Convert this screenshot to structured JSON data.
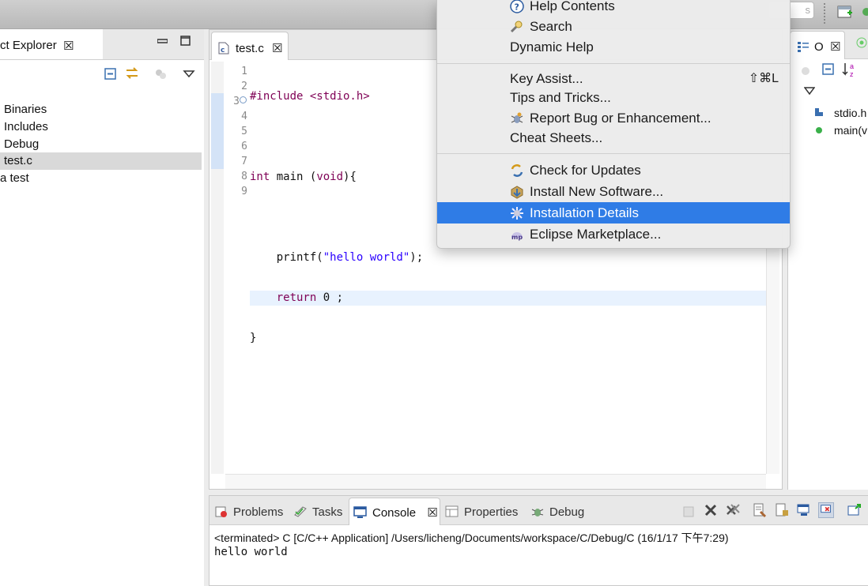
{
  "toolbar": {
    "quick_access_placeholder": "s"
  },
  "explorer": {
    "title": "ct Explorer",
    "close": "☒",
    "items": [
      {
        "label": "Binaries"
      },
      {
        "label": "Includes"
      },
      {
        "label": "Debug"
      },
      {
        "label": "test.c"
      },
      {
        "label": "a  test"
      }
    ]
  },
  "editor": {
    "tab_label": "test.c",
    "tab_close": "☒",
    "line_numbers": [
      "1",
      "2",
      "3",
      "4",
      "5",
      "6",
      "7",
      "8",
      "9"
    ],
    "code": {
      "line1": "#include <stdio.h>",
      "line3_kw": "int",
      "line3_rest": " main (",
      "line3_kw2": "void",
      "line3_end": "){",
      "line5_a": "    printf(",
      "line5_str": "\"hello world\"",
      "line5_b": ");",
      "line6_kw": "    return",
      "line6_rest": " 0 ;",
      "line7": "}"
    }
  },
  "outline": {
    "label": "O",
    "close": "☒",
    "items": [
      {
        "label": "stdio.h"
      },
      {
        "label": "main(v"
      }
    ]
  },
  "console": {
    "tabs": [
      "Problems",
      "Tasks",
      "Console",
      "Properties",
      "Debug"
    ],
    "tab_close": "☒",
    "status": "<terminated> C [C/C++ Application] /Users/licheng/Documents/workspace/C/Debug/C (16/1/17 下午7:29)",
    "output": "hello world"
  },
  "help_menu": {
    "items": {
      "help_contents": "Help Contents",
      "search": "Search",
      "dynamic_help": "Dynamic Help",
      "key_assist": "Key Assist...",
      "key_assist_shortcut": "⇧⌘L",
      "tips": "Tips and Tricks...",
      "report_bug": "Report Bug or Enhancement...",
      "cheat_sheets": "Cheat Sheets...",
      "check_updates": "Check for Updates",
      "install_new": "Install New Software...",
      "installation_details": "Installation Details",
      "marketplace": "Eclipse Marketplace..."
    }
  },
  "colors": {
    "menu_highlight": "#2f7ce6",
    "keyword": "#7f0055",
    "string": "#2a00ff"
  }
}
